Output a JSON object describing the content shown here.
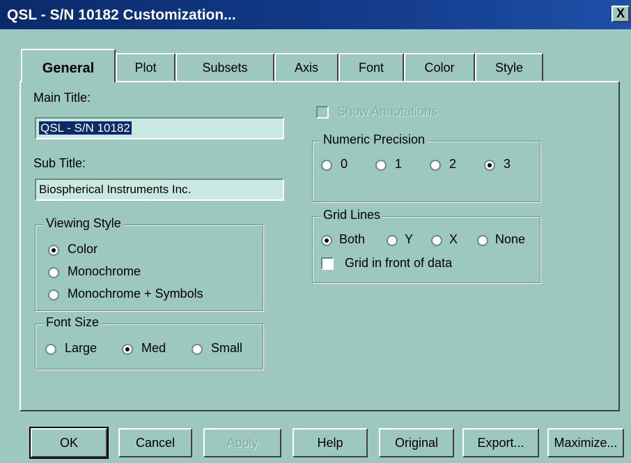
{
  "window": {
    "title": "QSL - S/N 10182 Customization...",
    "close_label": "X"
  },
  "tabs": [
    {
      "label": "General",
      "active": true
    },
    {
      "label": "Plot"
    },
    {
      "label": "Subsets"
    },
    {
      "label": "Axis"
    },
    {
      "label": "Font"
    },
    {
      "label": "Color"
    },
    {
      "label": "Style"
    }
  ],
  "main_title": {
    "label": "Main Title:",
    "value": "QSL - S/N 10182"
  },
  "sub_title": {
    "label": "Sub Title:",
    "value": "Biospherical Instruments Inc."
  },
  "viewing_style": {
    "legend": "Viewing Style",
    "options": [
      "Color",
      "Monochrome",
      "Monochrome + Symbols"
    ],
    "selected": "Color"
  },
  "font_size": {
    "legend": "Font Size",
    "options": [
      "Large",
      "Med",
      "Small"
    ],
    "selected": "Med"
  },
  "show_annotations": {
    "label": "Show Annotations",
    "enabled": false,
    "checked": false
  },
  "numeric_precision": {
    "legend": "Numeric Precision",
    "options": [
      "0",
      "1",
      "2",
      "3"
    ],
    "selected": "3"
  },
  "grid_lines": {
    "legend": "Grid Lines",
    "options": [
      "Both",
      "Y",
      "X",
      "None"
    ],
    "selected": "Both",
    "front_label": "Grid in front of data",
    "front_checked": false
  },
  "buttons": {
    "ok": "OK",
    "cancel": "Cancel",
    "apply": "Apply",
    "help": "Help",
    "original": "Original",
    "export": "Export...",
    "maximize": "Maximize..."
  },
  "colors": {
    "face": "#9cc8bf",
    "title_bar": "#0a2a6a",
    "field": "#c8e8e0"
  }
}
